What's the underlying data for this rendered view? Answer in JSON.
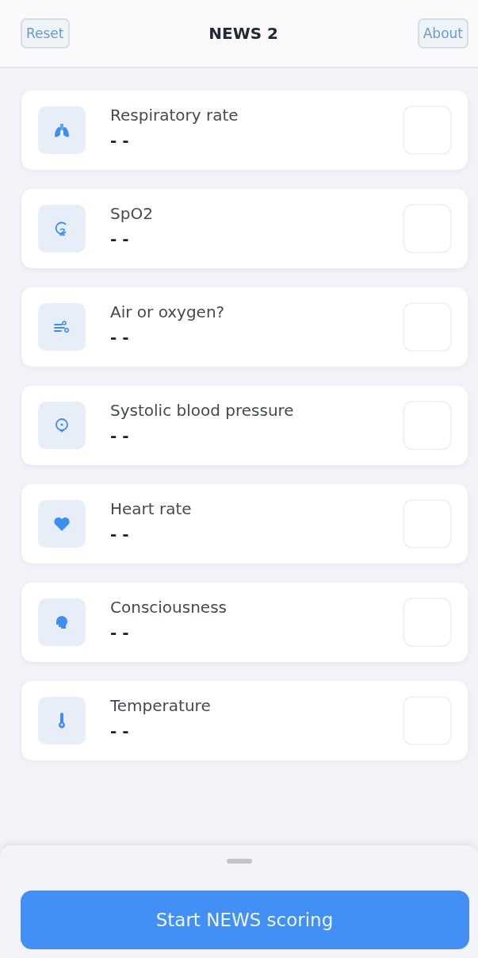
{
  "header": {
    "left_button": "Reset",
    "title": "NEWS 2",
    "right_button": "About"
  },
  "parameters": [
    {
      "kind": "lungs",
      "label": "Respiratory rate",
      "value": "- -"
    },
    {
      "kind": "spo2",
      "label": "SpO2",
      "value": "- -"
    },
    {
      "kind": "air",
      "label": "Air or oxygen?",
      "value": "- -"
    },
    {
      "kind": "pressure",
      "label": "Systolic blood pressure",
      "value": "- -"
    },
    {
      "kind": "heart",
      "label": "Heart rate",
      "value": "- -"
    },
    {
      "kind": "head",
      "label": "Consciousness",
      "value": "- -"
    },
    {
      "kind": "thermometer",
      "label": "Temperature",
      "value": "- -"
    }
  ],
  "footer": {
    "button": "Start NEWS scoring"
  }
}
